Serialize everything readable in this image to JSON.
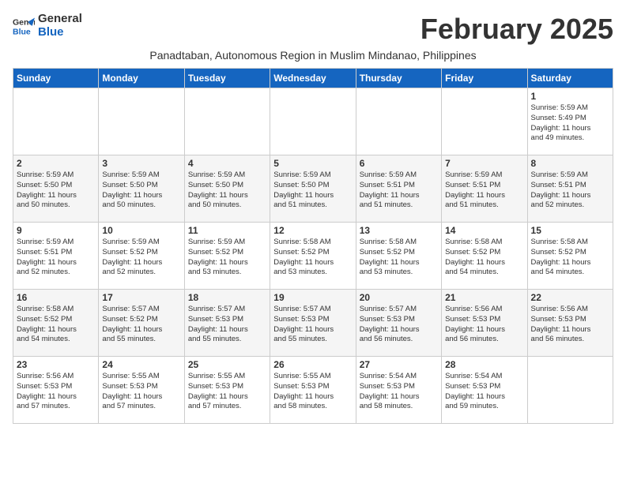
{
  "logo": {
    "line1": "General",
    "line2": "Blue"
  },
  "title": "February 2025",
  "subtitle": "Panadtaban, Autonomous Region in Muslim Mindanao, Philippines",
  "days_of_week": [
    "Sunday",
    "Monday",
    "Tuesday",
    "Wednesday",
    "Thursday",
    "Friday",
    "Saturday"
  ],
  "weeks": [
    [
      {
        "day": "",
        "info": ""
      },
      {
        "day": "",
        "info": ""
      },
      {
        "day": "",
        "info": ""
      },
      {
        "day": "",
        "info": ""
      },
      {
        "day": "",
        "info": ""
      },
      {
        "day": "",
        "info": ""
      },
      {
        "day": "1",
        "info": "Sunrise: 5:59 AM\nSunset: 5:49 PM\nDaylight: 11 hours\nand 49 minutes."
      }
    ],
    [
      {
        "day": "2",
        "info": "Sunrise: 5:59 AM\nSunset: 5:50 PM\nDaylight: 11 hours\nand 50 minutes."
      },
      {
        "day": "3",
        "info": "Sunrise: 5:59 AM\nSunset: 5:50 PM\nDaylight: 11 hours\nand 50 minutes."
      },
      {
        "day": "4",
        "info": "Sunrise: 5:59 AM\nSunset: 5:50 PM\nDaylight: 11 hours\nand 50 minutes."
      },
      {
        "day": "5",
        "info": "Sunrise: 5:59 AM\nSunset: 5:50 PM\nDaylight: 11 hours\nand 51 minutes."
      },
      {
        "day": "6",
        "info": "Sunrise: 5:59 AM\nSunset: 5:51 PM\nDaylight: 11 hours\nand 51 minutes."
      },
      {
        "day": "7",
        "info": "Sunrise: 5:59 AM\nSunset: 5:51 PM\nDaylight: 11 hours\nand 51 minutes."
      },
      {
        "day": "8",
        "info": "Sunrise: 5:59 AM\nSunset: 5:51 PM\nDaylight: 11 hours\nand 52 minutes."
      }
    ],
    [
      {
        "day": "9",
        "info": "Sunrise: 5:59 AM\nSunset: 5:51 PM\nDaylight: 11 hours\nand 52 minutes."
      },
      {
        "day": "10",
        "info": "Sunrise: 5:59 AM\nSunset: 5:52 PM\nDaylight: 11 hours\nand 52 minutes."
      },
      {
        "day": "11",
        "info": "Sunrise: 5:59 AM\nSunset: 5:52 PM\nDaylight: 11 hours\nand 53 minutes."
      },
      {
        "day": "12",
        "info": "Sunrise: 5:58 AM\nSunset: 5:52 PM\nDaylight: 11 hours\nand 53 minutes."
      },
      {
        "day": "13",
        "info": "Sunrise: 5:58 AM\nSunset: 5:52 PM\nDaylight: 11 hours\nand 53 minutes."
      },
      {
        "day": "14",
        "info": "Sunrise: 5:58 AM\nSunset: 5:52 PM\nDaylight: 11 hours\nand 54 minutes."
      },
      {
        "day": "15",
        "info": "Sunrise: 5:58 AM\nSunset: 5:52 PM\nDaylight: 11 hours\nand 54 minutes."
      }
    ],
    [
      {
        "day": "16",
        "info": "Sunrise: 5:58 AM\nSunset: 5:52 PM\nDaylight: 11 hours\nand 54 minutes."
      },
      {
        "day": "17",
        "info": "Sunrise: 5:57 AM\nSunset: 5:52 PM\nDaylight: 11 hours\nand 55 minutes."
      },
      {
        "day": "18",
        "info": "Sunrise: 5:57 AM\nSunset: 5:53 PM\nDaylight: 11 hours\nand 55 minutes."
      },
      {
        "day": "19",
        "info": "Sunrise: 5:57 AM\nSunset: 5:53 PM\nDaylight: 11 hours\nand 55 minutes."
      },
      {
        "day": "20",
        "info": "Sunrise: 5:57 AM\nSunset: 5:53 PM\nDaylight: 11 hours\nand 56 minutes."
      },
      {
        "day": "21",
        "info": "Sunrise: 5:56 AM\nSunset: 5:53 PM\nDaylight: 11 hours\nand 56 minutes."
      },
      {
        "day": "22",
        "info": "Sunrise: 5:56 AM\nSunset: 5:53 PM\nDaylight: 11 hours\nand 56 minutes."
      }
    ],
    [
      {
        "day": "23",
        "info": "Sunrise: 5:56 AM\nSunset: 5:53 PM\nDaylight: 11 hours\nand 57 minutes."
      },
      {
        "day": "24",
        "info": "Sunrise: 5:55 AM\nSunset: 5:53 PM\nDaylight: 11 hours\nand 57 minutes."
      },
      {
        "day": "25",
        "info": "Sunrise: 5:55 AM\nSunset: 5:53 PM\nDaylight: 11 hours\nand 57 minutes."
      },
      {
        "day": "26",
        "info": "Sunrise: 5:55 AM\nSunset: 5:53 PM\nDaylight: 11 hours\nand 58 minutes."
      },
      {
        "day": "27",
        "info": "Sunrise: 5:54 AM\nSunset: 5:53 PM\nDaylight: 11 hours\nand 58 minutes."
      },
      {
        "day": "28",
        "info": "Sunrise: 5:54 AM\nSunset: 5:53 PM\nDaylight: 11 hours\nand 59 minutes."
      },
      {
        "day": "",
        "info": ""
      }
    ]
  ]
}
